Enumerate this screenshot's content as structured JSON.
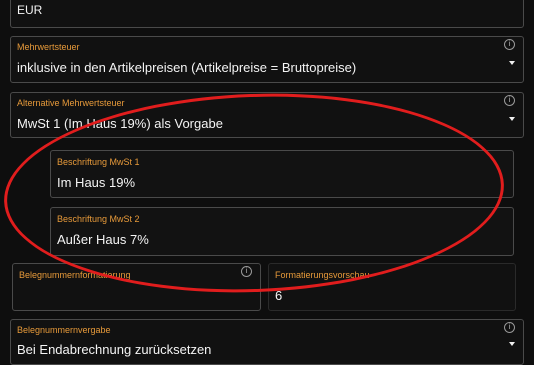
{
  "currency": {
    "value": "EUR"
  },
  "vat": {
    "label": "Mehrwertsteuer",
    "value": "inklusive in den Artikelpreisen (Artikelpreise = Bruttopreise)",
    "info_icon": "info-icon"
  },
  "alt_vat": {
    "label": "Alternative Mehrwertsteuer",
    "value": "MwSt 1 (Im Haus 19%) als Vorgabe",
    "info_icon": "info-icon"
  },
  "vat_label_1": {
    "label": "Beschriftung MwSt 1",
    "value": "Im Haus 19%"
  },
  "vat_label_2": {
    "label": "Beschriftung MwSt 2",
    "value": "Außer Haus 7%"
  },
  "receipt_format": {
    "label": "Belegnummernformatierung",
    "value": "",
    "info_icon": "info-icon"
  },
  "format_preview": {
    "label": "Formatierungsvorschau",
    "value": "6"
  },
  "receipt_assignment": {
    "label": "Belegnummernvergabe",
    "value": "Bei Endabrechnung zurücksetzen",
    "info_icon": "info-icon"
  },
  "colors": {
    "accent": "#e79a3a",
    "annotation": "#e11d1d",
    "background": "#0e0e0e"
  }
}
